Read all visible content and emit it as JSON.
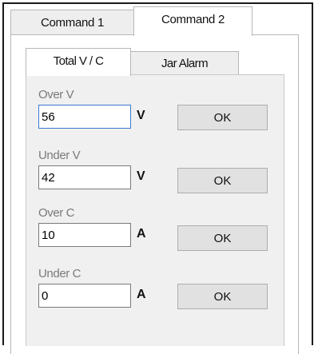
{
  "outer_tabs": [
    {
      "label": "Command 1",
      "active": false
    },
    {
      "label": "Command 2",
      "active": true
    }
  ],
  "inner_tabs": [
    {
      "label": "Total V / C",
      "active": true
    },
    {
      "label": "Jar Alarm",
      "active": false
    }
  ],
  "fields": [
    {
      "label": "Over V",
      "value": "56",
      "unit": "V",
      "button": "OK",
      "focused": true
    },
    {
      "label": "Under V",
      "value": "42",
      "unit": "V",
      "button": "OK",
      "focused": false
    },
    {
      "label": "Over C",
      "value": "10",
      "unit": "A",
      "button": "OK",
      "focused": false
    },
    {
      "label": "Under C",
      "value": "0",
      "unit": "A",
      "button": "OK",
      "focused": false
    }
  ],
  "colors": {
    "panel_bg": "#f0f0f0",
    "label_gray": "#7a7a7a",
    "focus_border": "#3b7bd4",
    "button_bg": "#e1e1e1"
  }
}
